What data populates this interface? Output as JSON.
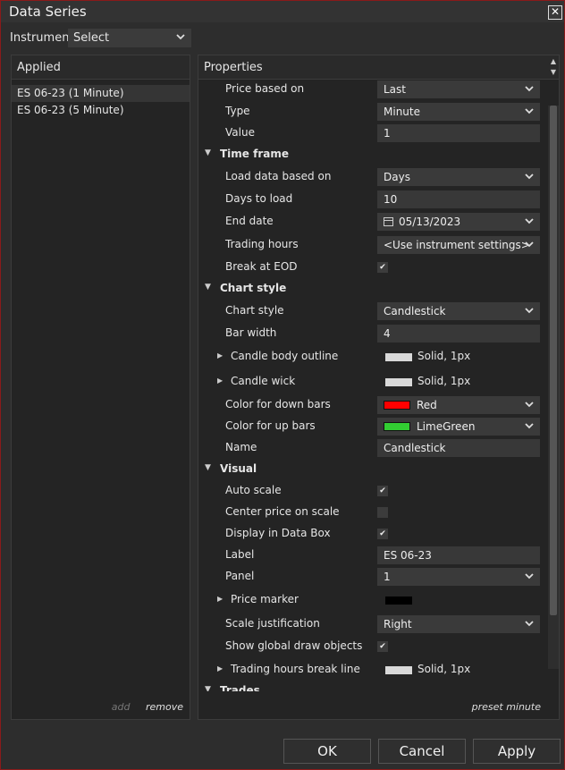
{
  "window": {
    "title": "Data Series",
    "close_glyph": "✕"
  },
  "instrument": {
    "label": "Instrument",
    "selected": "Select"
  },
  "applied": {
    "header": "Applied",
    "items": [
      "ES 06-23 (1 Minute)",
      "ES 06-23 (5 Minute)"
    ],
    "add_label": "add",
    "remove_label": "remove"
  },
  "properties": {
    "header": "Properties",
    "preset_label": "preset minute",
    "rows": [
      {
        "kind": "prop",
        "label": "Price based on",
        "value": "Last",
        "type": "dropdown"
      },
      {
        "kind": "prop",
        "label": "Type",
        "value": "Minute",
        "type": "dropdown"
      },
      {
        "kind": "prop",
        "label": "Value",
        "value": "1",
        "type": "text"
      },
      {
        "kind": "cat",
        "label": "Time frame"
      },
      {
        "kind": "prop",
        "label": "Load data based on",
        "value": "Days",
        "type": "dropdown"
      },
      {
        "kind": "prop",
        "label": "Days to load",
        "value": "10",
        "type": "text"
      },
      {
        "kind": "prop",
        "label": "End date",
        "value": "05/13/2023",
        "type": "date"
      },
      {
        "kind": "prop",
        "label": "Trading hours",
        "value": "<Use instrument settings>",
        "type": "dropdown"
      },
      {
        "kind": "prop",
        "label": "Break at EOD",
        "checked": true,
        "type": "check"
      },
      {
        "kind": "cat",
        "label": "Chart style"
      },
      {
        "kind": "prop",
        "label": "Chart style",
        "value": "Candlestick",
        "type": "dropdown"
      },
      {
        "kind": "prop",
        "label": "Bar width",
        "value": "4",
        "type": "text"
      },
      {
        "kind": "sub",
        "label": "Candle body outline",
        "value": "Solid, 1px",
        "swatch": "#d9d9d9",
        "type": "stroke"
      },
      {
        "kind": "sub",
        "label": "Candle wick",
        "value": "Solid, 1px",
        "swatch": "#d9d9d9",
        "type": "stroke"
      },
      {
        "kind": "prop",
        "label": "Color for down bars",
        "value": "Red",
        "swatch": "#ff0000",
        "type": "color"
      },
      {
        "kind": "prop",
        "label": "Color for up bars",
        "value": "LimeGreen",
        "swatch": "#32cd32",
        "type": "color"
      },
      {
        "kind": "prop",
        "label": "Name",
        "value": "Candlestick",
        "type": "text"
      },
      {
        "kind": "cat",
        "label": "Visual"
      },
      {
        "kind": "prop",
        "label": "Auto scale",
        "checked": true,
        "type": "check"
      },
      {
        "kind": "prop",
        "label": "Center price on scale",
        "checked": false,
        "type": "check"
      },
      {
        "kind": "prop",
        "label": "Display in Data Box",
        "checked": true,
        "type": "check"
      },
      {
        "kind": "prop",
        "label": "Label",
        "value": "ES 06-23",
        "type": "text"
      },
      {
        "kind": "prop",
        "label": "Panel",
        "value": "1",
        "type": "dropdown"
      },
      {
        "kind": "sub",
        "label": "Price marker",
        "swatch": "#000000",
        "type": "marker"
      },
      {
        "kind": "prop",
        "label": "Scale justification",
        "value": "Right",
        "type": "dropdown"
      },
      {
        "kind": "prop",
        "label": "Show global draw objects",
        "checked": true,
        "type": "check"
      },
      {
        "kind": "sub",
        "label": "Trading hours break line",
        "value": "Solid, 1px",
        "swatch": "#d9d9d9",
        "type": "stroke"
      },
      {
        "kind": "cat",
        "label": "Trades"
      }
    ]
  },
  "buttons": {
    "ok": "OK",
    "cancel": "Cancel",
    "apply": "Apply"
  },
  "colors": {
    "accent_border": "#8a1a1a",
    "background": "#2d2d2d",
    "panel": "#242424"
  }
}
